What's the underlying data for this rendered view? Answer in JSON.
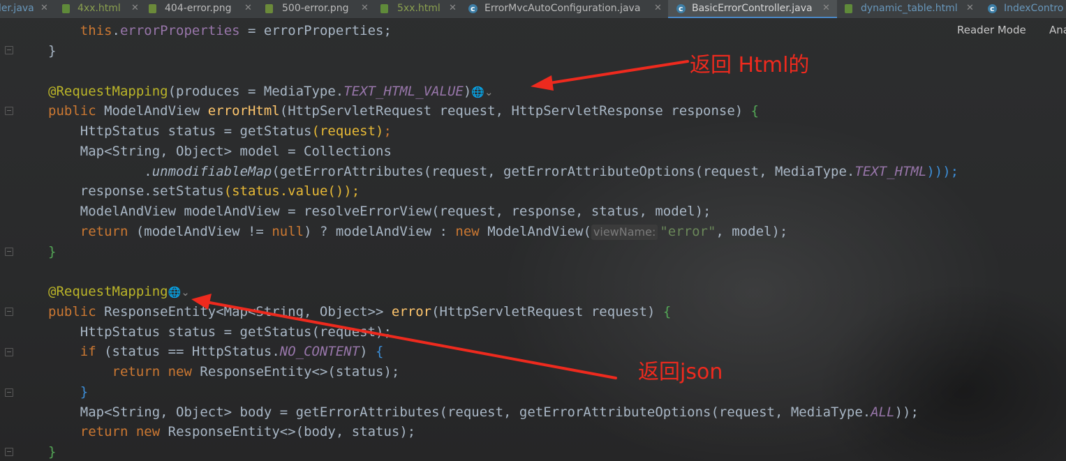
{
  "tabs": [
    {
      "label": "ler.java",
      "icon": "java-class-icon",
      "active": false
    },
    {
      "label": "4xx.html",
      "icon": "html-file-icon",
      "active": false
    },
    {
      "label": "404-error.png",
      "icon": "image-file-icon",
      "active": false
    },
    {
      "label": "500-error.png",
      "icon": "image-file-icon",
      "active": false
    },
    {
      "label": "5xx.html",
      "icon": "html-file-icon",
      "active": false
    },
    {
      "label": "ErrorMvcAutoConfiguration.java",
      "icon": "java-class-icon",
      "active": false
    },
    {
      "label": "BasicErrorController.java",
      "icon": "java-class-icon",
      "active": true
    },
    {
      "label": "dynamic_table.html",
      "icon": "html-file-icon",
      "active": false
    },
    {
      "label": "IndexContro",
      "icon": "java-class-icon",
      "active": false
    }
  ],
  "toolbar": {
    "reader_mode": "Reader Mode",
    "ana": "Ana"
  },
  "code": {
    "t_this": "this",
    "t_dot": ".",
    "t_errorProperties": "errorProperties",
    "t_assign_errorProperties": " = errorProperties;",
    "t_rbrace": "}",
    "t_annotation": "@RequestMapping",
    "t_produces": "(produces = MediaType.",
    "t_TEXT_HTML_VALUE": "TEXT_HTML_VALUE",
    "t_rparen": ")",
    "t_public": "public",
    "t_ModelAndView": " ModelAndView ",
    "t_errorHtml": "errorHtml",
    "t_errorHtml_params": "(HttpServletRequest request, HttpServletResponse response) ",
    "t_lbrace": "{",
    "t_status_decl": "HttpStatus status = getStatus",
    "t_request_arg": "(request)",
    "t_semicolon": ";",
    "t_map_decl": "Map<String, Object> model = Collections",
    "t_dot_unmod": ".",
    "t_unmodifiableMap": "unmodifiableMap",
    "t_getErrorAttributes_call": "(getErrorAttributes(request, getErrorAttributeOptions(request, MediaType.",
    "t_TEXT_HTML": "TEXT_HTML",
    "t_close3": ")));",
    "t_setStatus": "response.setStatus",
    "t_status_value": "(status.value());",
    "t_resolve": "ModelAndView modelAndView = resolveErrorView(request, response, status, model);",
    "t_return": "return",
    "t_ret_expr1": " (modelAndView != ",
    "t_null": "null",
    "t_ret_expr2": ") ? modelAndView : ",
    "t_new": "new",
    "t_ret_expr3": " ModelAndView(",
    "t_hint_viewName": "viewName:",
    "t_error_str": "\"error\"",
    "t_ret_expr4": ", model);",
    "t_ResponseEntity_sig": " ResponseEntity<Map<String, Object>> ",
    "t_error_fn": "error",
    "t_error_params": "(HttpServletRequest request) ",
    "t_status_decl2": "HttpStatus status = getStatus(request);",
    "t_if": "if",
    "t_if_cond1": " (status == HttpStatus.",
    "t_NO_CONTENT": "NO_CONTENT",
    "t_if_cond2": ") ",
    "t_ret_new_entity": " ResponseEntity<>(status);",
    "t_body_decl": "Map<String, Object> body = getErrorAttributes(request, getErrorAttributeOptions(request, MediaType.",
    "t_ALL": "ALL",
    "t_close2": "));",
    "t_ret_new_entity2": " ResponseEntity<>(body, status);",
    "t_globe": "🌐",
    "t_chev": "⌄"
  },
  "annotations": {
    "html_note": "返回 Html的",
    "json_note": "返回json",
    "arrow_color": "#ee2a1e"
  }
}
